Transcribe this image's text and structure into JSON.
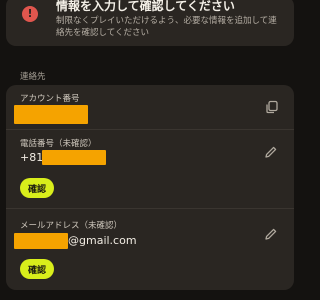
{
  "alert": {
    "icon": "alert-circle-icon",
    "title": "情報を入力して確認してください",
    "body": "制限なくプレイいただけるよう、必要な情報を追加して連絡先を確認してください"
  },
  "contacts": {
    "section_label": "連絡先",
    "account_email": {
      "label": "アカウント番号",
      "copy_icon": "copy-icon"
    },
    "phone": {
      "label": "電話番号（未確認）",
      "prefix": "+81",
      "edit_icon": "pencil-icon",
      "confirm_label": "確認"
    },
    "email": {
      "label": "メールアドレス（未確認）",
      "domain": "@gmail.com",
      "edit_icon": "pencil-icon",
      "confirm_label": "確認"
    }
  },
  "colors": {
    "background": "#141210",
    "card": "#2a2622",
    "accent": "#d9ee1b",
    "alert": "#e0564e",
    "redaction": "#f5a300"
  }
}
